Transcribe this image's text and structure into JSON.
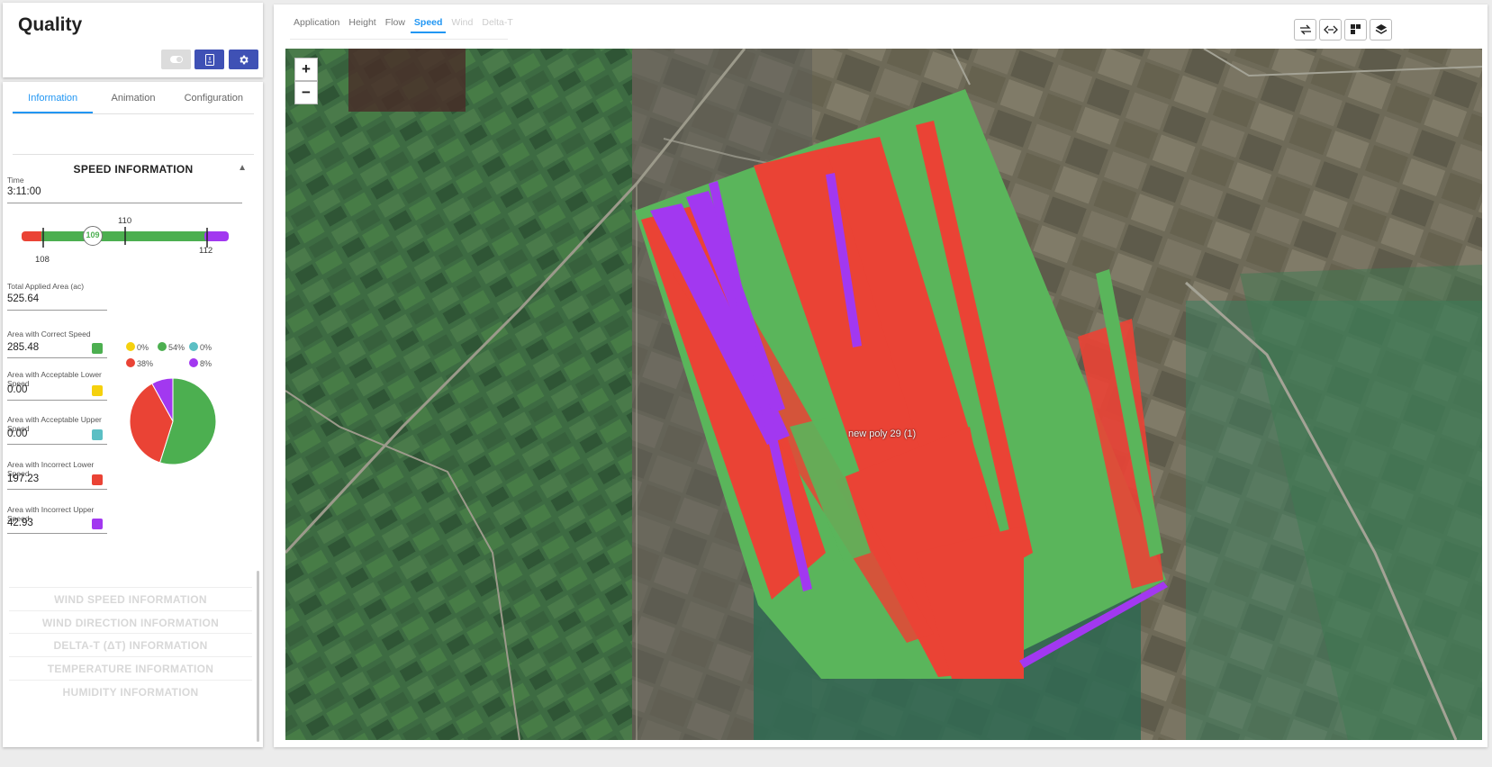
{
  "header": {
    "title": "Quality"
  },
  "tabs": [
    {
      "label": "Information",
      "active": true
    },
    {
      "label": "Animation",
      "active": false
    },
    {
      "label": "Configuration",
      "active": false
    }
  ],
  "speed_section": {
    "title": "SPEED INFORMATION",
    "time_label": "Time",
    "time_value": "3:11:00",
    "gauge": {
      "current": "109",
      "low": "108",
      "mid": "110",
      "high": "112"
    },
    "total_label": "Total Applied Area (ac)",
    "total_value": "525.64",
    "rows": [
      {
        "label": "Area with Correct Speed",
        "value": "285.48",
        "color": "#4caf50"
      },
      {
        "label": "Area with Acceptable Lower Speed",
        "value": "0.00",
        "color": "#f5d10d"
      },
      {
        "label": "Area with Acceptable Upper Speed",
        "value": "0.00",
        "color": "#5bbfc4"
      },
      {
        "label": "Area with Incorrect Lower Speed",
        "value": "197.23",
        "color": "#ea4335"
      },
      {
        "label": "Area with Incorrect Upper Speed",
        "value": "42.93",
        "color": "#a238f0"
      }
    ],
    "legend": [
      {
        "pct": "0%",
        "color": "#f5d10d"
      },
      {
        "pct": "54%",
        "color": "#4caf50"
      },
      {
        "pct": "0%",
        "color": "#5bbfc4"
      },
      {
        "pct": "38%",
        "color": "#ea4335"
      },
      {
        "pct": "8%",
        "color": "#a238f0"
      }
    ]
  },
  "collapsed_sections": [
    "WIND SPEED INFORMATION",
    "WIND DIRECTION INFORMATION",
    "DELTA-T (ΔT) INFORMATION",
    "TEMPERATURE INFORMATION",
    "HUMIDITY INFORMATION"
  ],
  "map_tabs": [
    {
      "label": "Application",
      "state": "normal"
    },
    {
      "label": "Height",
      "state": "normal"
    },
    {
      "label": "Flow",
      "state": "normal"
    },
    {
      "label": "Speed",
      "state": "active"
    },
    {
      "label": "Wind",
      "state": "disabled"
    },
    {
      "label": "Delta-T",
      "state": "disabled"
    }
  ],
  "map": {
    "zoom_in": "+",
    "zoom_out": "−",
    "polygon_label": "new poly 29 (1)"
  },
  "toolbar_icons": [
    "swap-icon",
    "code-arrows-icon",
    "layout-icon",
    "layers-icon"
  ]
}
